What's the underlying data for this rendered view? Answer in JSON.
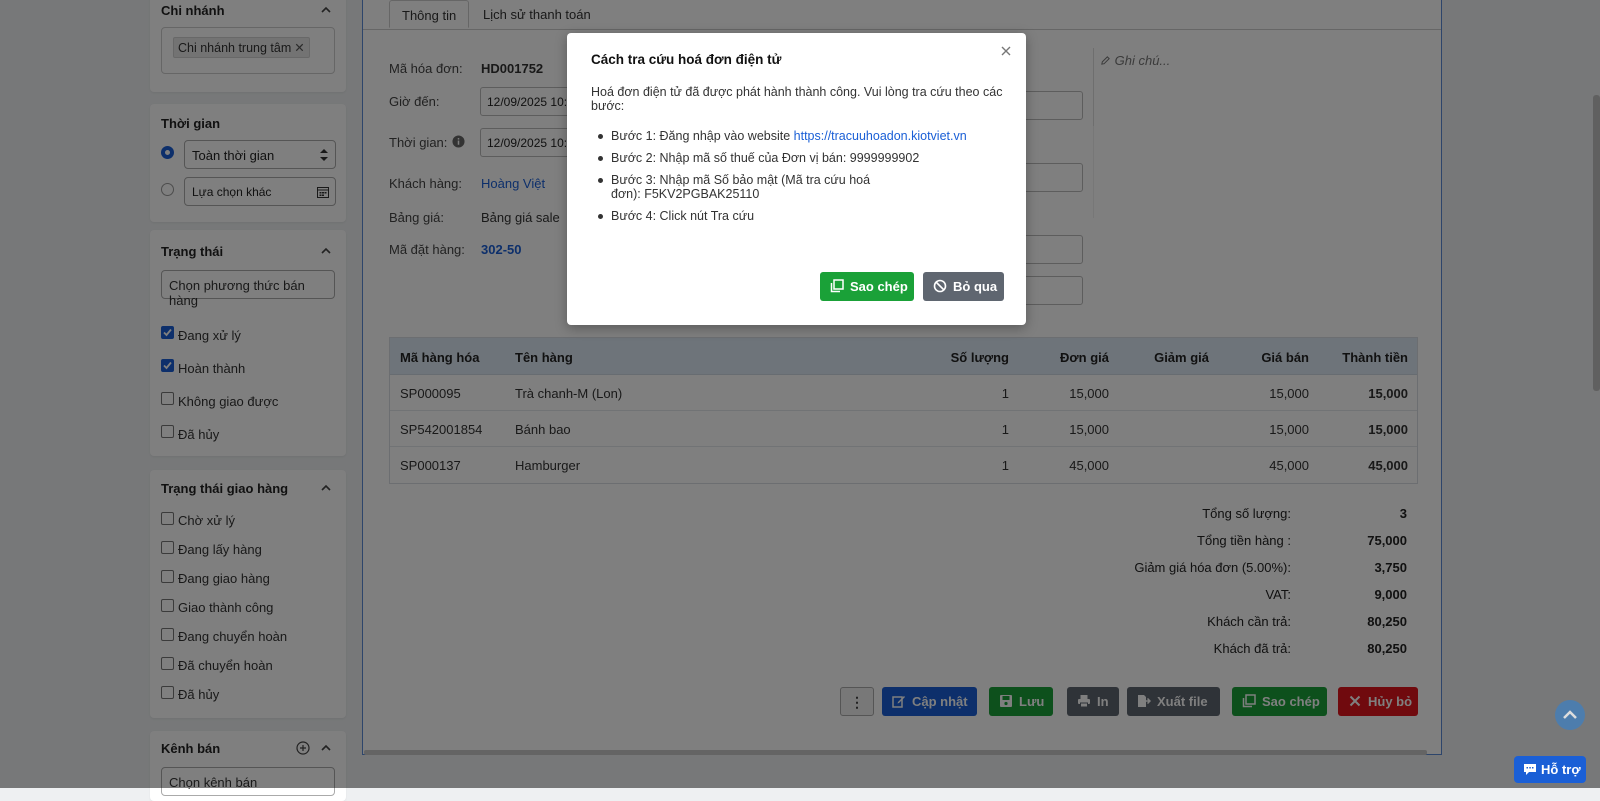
{
  "sidebar": {
    "branch": {
      "title": "Chi nhánh",
      "tag": "Chi nhánh trung tâm",
      "tag_remove": "✕"
    },
    "time": {
      "title": "Thời gian",
      "option_all": "Toàn thời gian",
      "option_custom": "Lựa chọn khác",
      "selected": "option_all"
    },
    "status": {
      "title": "Trạng thái",
      "placeholder": "Chọn phương thức bán hàng",
      "items": [
        {
          "label": "Đang xử lý",
          "checked": true
        },
        {
          "label": "Hoàn thành",
          "checked": true
        },
        {
          "label": "Không giao được",
          "checked": false
        },
        {
          "label": "Đã hủy",
          "checked": false
        }
      ]
    },
    "delivery_status": {
      "title": "Trạng thái giao hàng",
      "items": [
        {
          "label": "Chờ xử lý",
          "checked": false
        },
        {
          "label": "Đang lấy hàng",
          "checked": false
        },
        {
          "label": "Đang giao hàng",
          "checked": false
        },
        {
          "label": "Giao thành công",
          "checked": false
        },
        {
          "label": "Đang chuyển hoàn",
          "checked": false
        },
        {
          "label": "Đã chuyển hoàn",
          "checked": false
        },
        {
          "label": "Đã hủy",
          "checked": false
        }
      ]
    },
    "channel": {
      "title": "Kênh bán",
      "placeholder": "Chọn kênh bán"
    }
  },
  "main": {
    "tabs": [
      {
        "label": "Thông tin",
        "active": true
      },
      {
        "label": "Lịch sử thanh toán",
        "active": false
      }
    ],
    "fields": {
      "invoice_code_label": "Mã hóa đơn:",
      "invoice_code": "HD001752",
      "arrival_label": "Giờ đến:",
      "arrival_value": "12/09/2025  10:",
      "time_label": "Thời gian:",
      "time_value": "12/09/2025  10:4",
      "customer_label": "Khách hàng:",
      "customer": "Hoàng Việt",
      "pricelist_label": "Bảng giá:",
      "pricelist": "Bảng giá sale",
      "order_code_label": "Mã đặt hàng:",
      "order_code": "302-50"
    },
    "note_placeholder": "Ghi chú...",
    "table": {
      "headers": [
        "Mã hàng hóa",
        "Tên hàng",
        "Số lượng",
        "Đơn giá",
        "Giảm giá",
        "Giá bán",
        "Thành tiền"
      ],
      "rows": [
        {
          "code": "SP000095",
          "name": "Trà chanh-M (Lon)",
          "qty": "1",
          "unit_price": "15,000",
          "discount": "",
          "price": "15,000",
          "total": "15,000"
        },
        {
          "code": "SP542001854",
          "name": "Bánh bao",
          "qty": "1",
          "unit_price": "15,000",
          "discount": "",
          "price": "15,000",
          "total": "15,000"
        },
        {
          "code": "SP000137",
          "name": "Hamburger",
          "qty": "1",
          "unit_price": "45,000",
          "discount": "",
          "price": "45,000",
          "total": "45,000"
        }
      ]
    },
    "summary": [
      {
        "label": "Tổng số lượng:",
        "value": "3"
      },
      {
        "label": "Tổng tiền hàng :",
        "value": "75,000"
      },
      {
        "label": "Giảm giá hóa đơn (5.00%):",
        "value": "3,750"
      },
      {
        "label": "VAT:",
        "value": "9,000"
      },
      {
        "label": "Khách cần trả:",
        "value": "80,250"
      },
      {
        "label": "Khách đã trả:",
        "value": "80,250"
      }
    ],
    "actions": {
      "more": "⋮",
      "update": "Cập nhật",
      "save": "Lưu",
      "print": "In",
      "export": "Xuất file",
      "copy": "Sao chép",
      "cancel": "Hủy bỏ"
    }
  },
  "modal": {
    "title": "Cách tra cứu hoá đơn điện tử",
    "description": "Hoá đơn điện tử đã được phát hành thành công. Vui lòng tra cứu theo các bước:",
    "step1_prefix": "Bước 1: Đăng nhập vào website ",
    "step1_link": "https://tracuuhoadon.kiotviet.vn",
    "step2": "Bước 2: Nhập mã số thuế của Đơn vị bán: 9999999902",
    "step3": "Bước 3: Nhập mã Số bảo mật (Mã tra cứu hoá đơn): F5KV2PGBAK25110",
    "step4": "Bước 4: Click nút Tra cứu",
    "copy_button": "Sao chép",
    "skip_button": "Bỏ qua"
  },
  "support": {
    "label": "Hỗ trợ"
  },
  "colors": {
    "primary": "#1a5fd6",
    "success": "#1aa138",
    "secondary": "#5f6670",
    "danger": "#e0141d",
    "table_header": "#dde9f5"
  },
  "icons": [
    "chevron-up-icon",
    "close-icon",
    "calendar-icon",
    "info-icon",
    "pencil-icon",
    "edit-icon",
    "save-icon",
    "print-icon",
    "export-icon",
    "copy-icon",
    "ban-icon",
    "x-icon",
    "add-circle-icon",
    "arrow-up-icon",
    "chat-icon"
  ]
}
